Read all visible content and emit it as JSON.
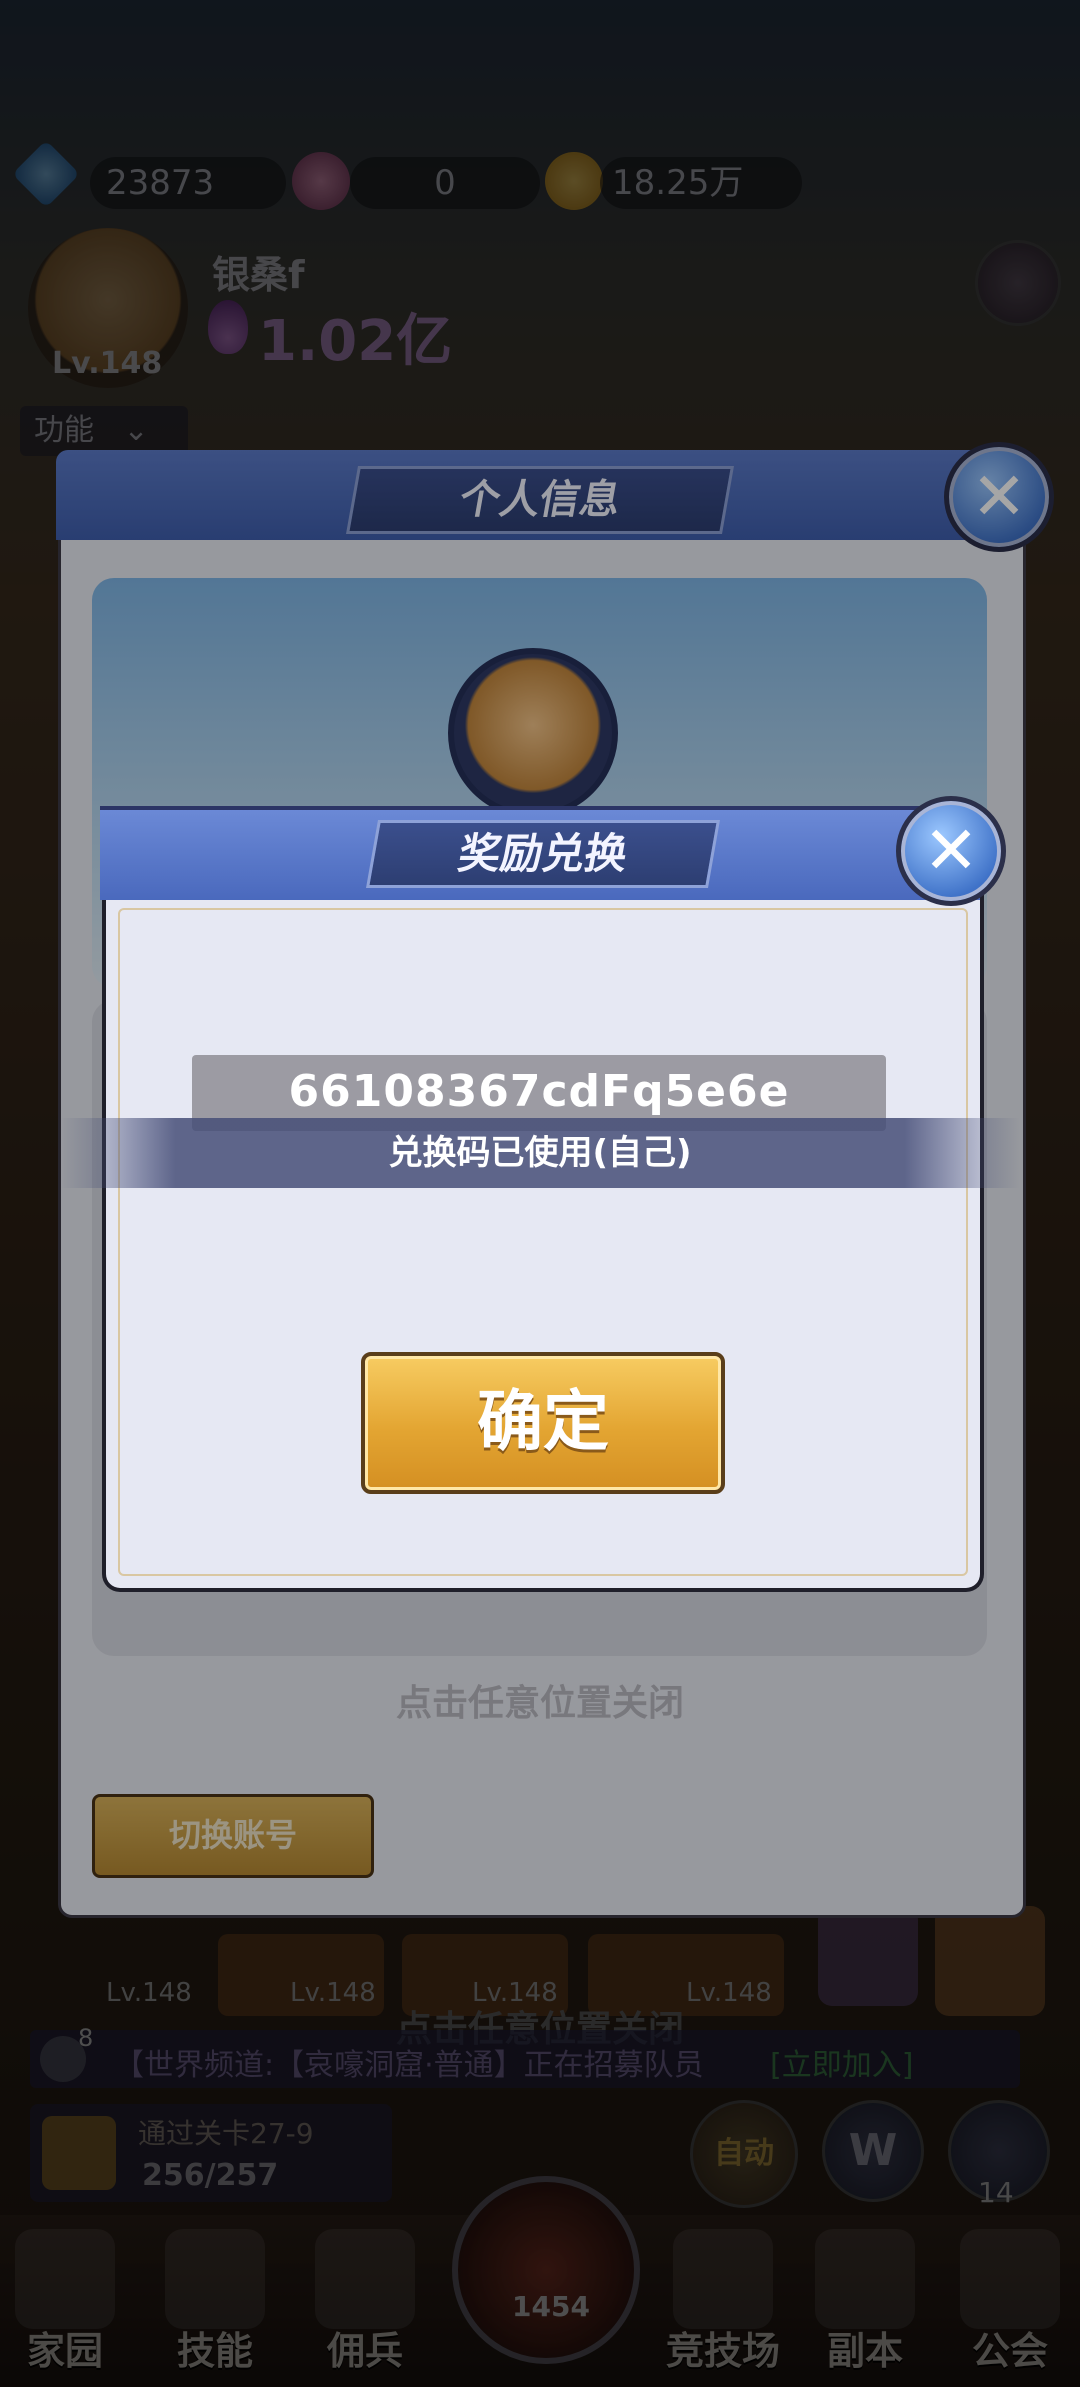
{
  "top_bar": {
    "diamonds": "23873",
    "gems": "0",
    "gold": "18.25万"
  },
  "player": {
    "name": "银桑f",
    "power": "1.02亿",
    "level": "Lv.148",
    "function_menu": "功能"
  },
  "profile_panel": {
    "title": "个人信息",
    "switch_account": "切换账号",
    "tap_to_close": "点击任意位置关闭"
  },
  "redeem_dialog": {
    "title": "奖励兑换",
    "code": "66108367cdFq5e6e",
    "status": "兑换码已使用(自己)",
    "confirm": "确定"
  },
  "background_hint": "点击任意位置关闭",
  "background": {
    "hero_levels": [
      "Lv.148",
      "Lv.148",
      "Lv.148",
      "Lv.148"
    ],
    "chat_count": "8",
    "chat_text": "【世界频道:【哀嚎洞窟·普通】正在招募队员",
    "chat_join": "[立即加入]",
    "stage_text": "通过关卡27-9",
    "stage_progress": "256/257",
    "auto_label": "自动",
    "w_badge": "W",
    "side_count": "14",
    "center_count": "1454"
  },
  "bottom_nav": [
    "家园",
    "技能",
    "佣兵",
    "竞技场",
    "副本",
    "公会"
  ],
  "colors": {
    "panel_blue": "#4a69bd",
    "button_gold": "#e3a532",
    "dialog_bg": "#e6e8f3"
  }
}
